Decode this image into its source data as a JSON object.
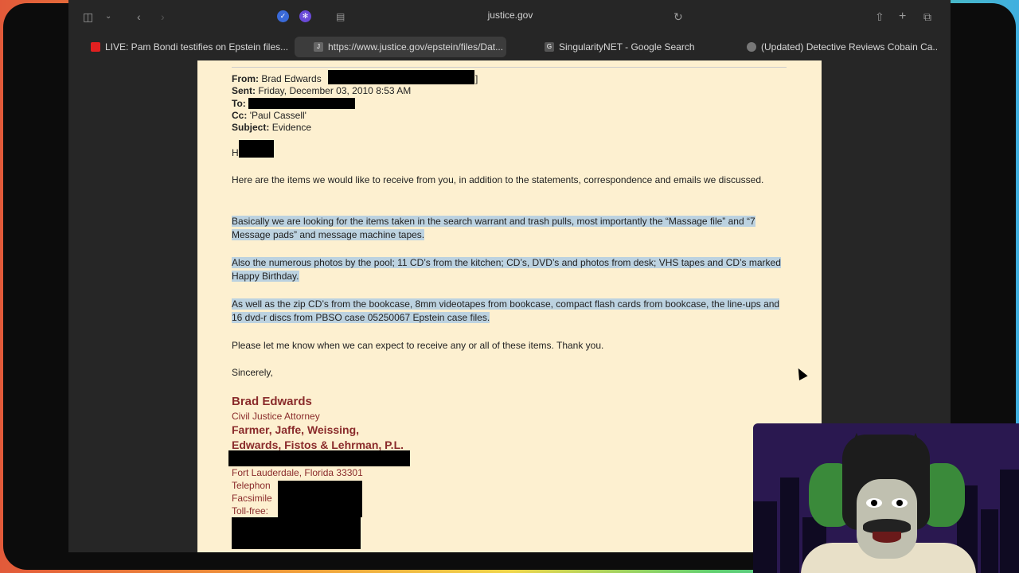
{
  "browser": {
    "address": "justice.gov",
    "tabs": [
      {
        "label": "LIVE: Pam Bondi testifies on Epstein files...",
        "icon": "youtube-icon",
        "active": false
      },
      {
        "label": "https://www.justice.gov/epstein/files/Dat...",
        "icon": "j-icon",
        "favicon_text": "J",
        "active": true
      },
      {
        "label": "SingularityNET - Google Search",
        "icon": "google-icon",
        "favicon_text": "G",
        "active": false
      },
      {
        "label": "(Updated) Detective Reviews Cobain Ca...",
        "icon": "brain-icon",
        "active": false
      }
    ]
  },
  "email": {
    "from_label": "From:",
    "from_value": "Brad Edwards",
    "from_bracket": "]",
    "sent_label": "Sent:",
    "sent_value": "Friday, December 03, 2010 8:53 AM",
    "to_label": "To:",
    "cc_label": "Cc:",
    "cc_value": "'Paul Cassell'",
    "subject_label": "Subject:",
    "subject_value": "Evidence",
    "greeting": "H",
    "para1": "Here are the items we would like to receive from you, in addition to the statements, correspondence and emails we discussed.",
    "para2": "Basically we are looking for the items taken in the search warrant and trash pulls, most importantly the “Massage file” and “7 Message pads” and message machine tapes.",
    "para3": "Also the numerous photos by the pool; 11 CD’s from the kitchen; CD’s, DVD’s and photos from desk; VHS tapes and CD’s marked Happy Birthday.",
    "para4": "As well as the zip CD’s from the bookcase, 8mm videotapes from bookcase, compact flash cards from bookcase, the line-ups and 16 dvd-r discs from PBSO case 05250067 Epstein case files.",
    "para5": "Please let me know when we can expect to receive any or all of these items.  Thank you.",
    "closing": "Sincerely,"
  },
  "signature": {
    "name": "Brad Edwards",
    "title": "Civil Justice Attorney",
    "firm_line1": "Farmer, Jaffe, Weissing,",
    "firm_line2": "Edwards, Fistos & Lehrman, P.L.",
    "city": "Fort Lauderdale, Florida 33301",
    "telephone": "Telephon",
    "facsimile": "Facsimile",
    "tollfree": "Toll-free:"
  },
  "colors": {
    "highlight": "#bcd2e0",
    "signature": "#8a2b2b",
    "document_bg": "#fdf0d0"
  }
}
